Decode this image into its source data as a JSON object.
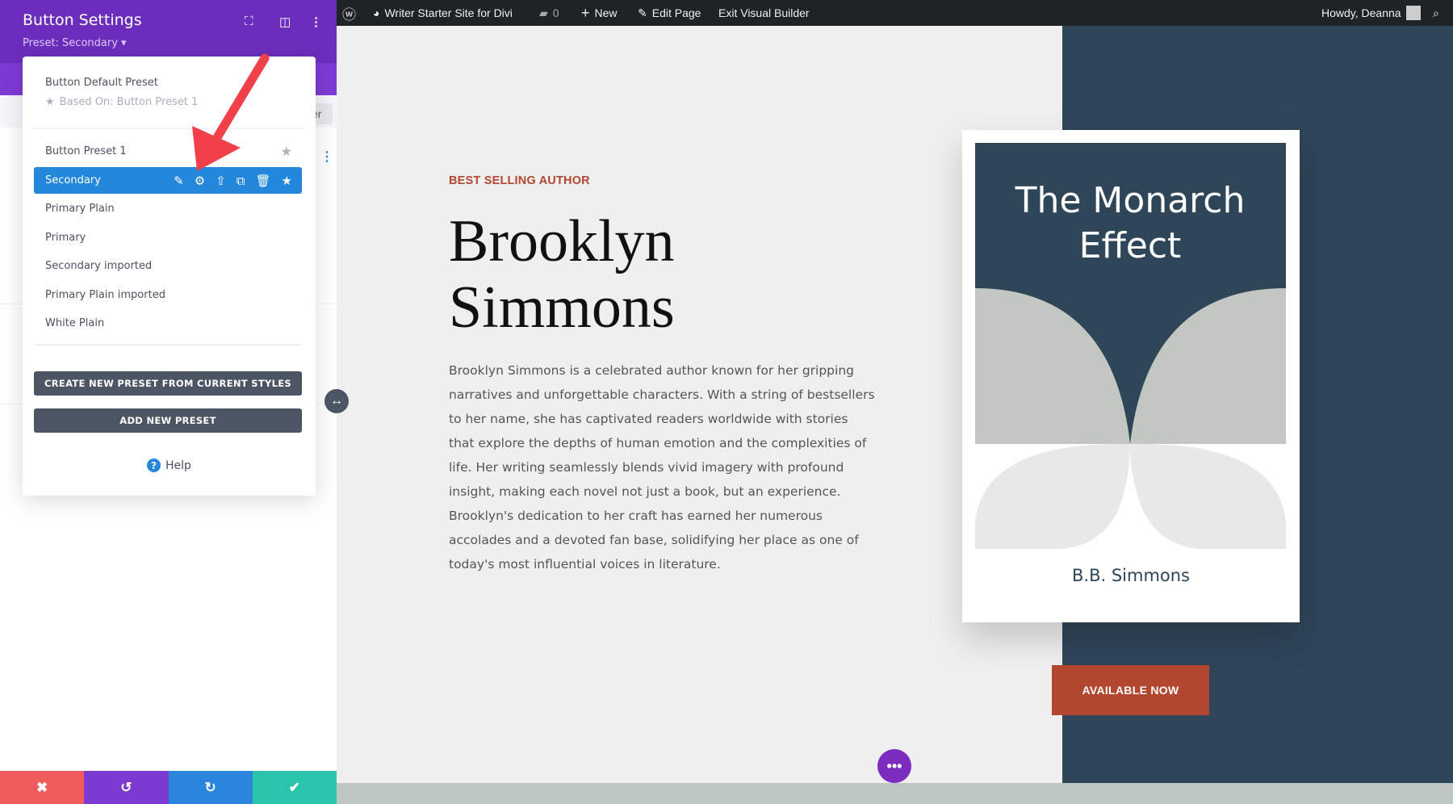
{
  "admin_bar": {
    "site_name": "Writer Starter Site for Divi",
    "comments_count": "0",
    "new_label": "New",
    "edit_page_label": "Edit Page",
    "exit_builder_label": "Exit Visual Builder",
    "greeting": "Howdy, Deanna"
  },
  "panel": {
    "title": "Button Settings",
    "preset_label": "Preset: Secondary",
    "partial_button_text": "er",
    "dropdown": {
      "default_preset": "Button Default Preset",
      "based_on": "Based On: Button Preset 1",
      "presets": [
        "Button Preset 1",
        "Secondary",
        "Primary Plain",
        "Primary",
        "Secondary imported",
        "Primary Plain imported",
        "White Plain"
      ],
      "selected": "Secondary",
      "create_button": "CREATE NEW PRESET FROM CURRENT STYLES",
      "add_button": "ADD NEW PRESET",
      "help": "Help"
    },
    "bottom_colors": {
      "cancel": "#f05c5c",
      "undo": "#7d3ad0",
      "redo": "#2a86dc",
      "save": "#29c4a9"
    }
  },
  "page": {
    "eyebrow": "BEST SELLING AUTHOR",
    "name_line1": "Brooklyn",
    "name_line2": "Simmons",
    "bio": "Brooklyn Simmons is a celebrated author known for her gripping narratives and unforgettable characters. With a string of bestsellers to her name, she has captivated readers worldwide with stories that explore the depths of human emotion and the complexities of life. Her writing seamlessly blends vivid imagery with profound insight, making each novel not just a book, but an experience. Brooklyn's dedication to her craft has earned her numerous accolades and a devoted fan base, solidifying her place as one of today's most influential voices in literature.",
    "book_title_line1": "The Monarch",
    "book_title_line2": "Effect",
    "book_author": "B.B. Simmons",
    "cta": "AVAILABLE NOW",
    "accent": "#b3462e",
    "dark": "#2f4558"
  }
}
